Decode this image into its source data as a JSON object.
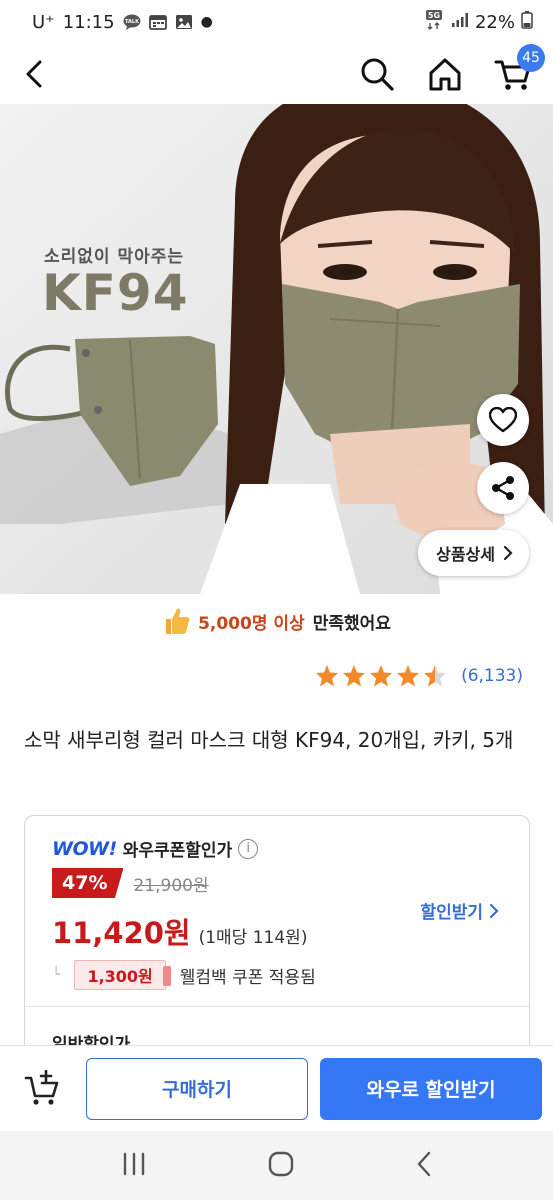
{
  "status_bar": {
    "carrier": "U⁺",
    "time": "11:15",
    "network": "5G",
    "battery": "22%"
  },
  "top_nav": {
    "cart_count": "45"
  },
  "hero": {
    "tagline": "소리없이 막아주는",
    "headline": "KF94",
    "detail_button": "상품상세"
  },
  "satisfaction": {
    "highlight": "5,000명 이상",
    "text": "만족했어요"
  },
  "rating": {
    "stars": 4.5,
    "count": "(6,133)"
  },
  "product": {
    "title": "소막 새부리형 컬러 마스크 대형 KF94, 20개입, 카키, 5개"
  },
  "price": {
    "wow_logo": "WOW!",
    "wow_label": "와우쿠폰할인가",
    "discount_pct": "47%",
    "original_price": "21,900원",
    "sale_price": "11,420원",
    "unit_price": "(1매당 114원)",
    "coupon_link": "할인받기",
    "coupon_amount": "1,300원",
    "coupon_text": "웰컴백 쿠폰 적용됨",
    "normal_label": "일반할인가"
  },
  "bottom_bar": {
    "buy_label": "구매하기",
    "wow_label": "와우로 할인받기"
  },
  "colors": {
    "accent_blue": "#3478f6",
    "price_red": "#c8191b",
    "mask_khaki": "#8a8a6e"
  }
}
